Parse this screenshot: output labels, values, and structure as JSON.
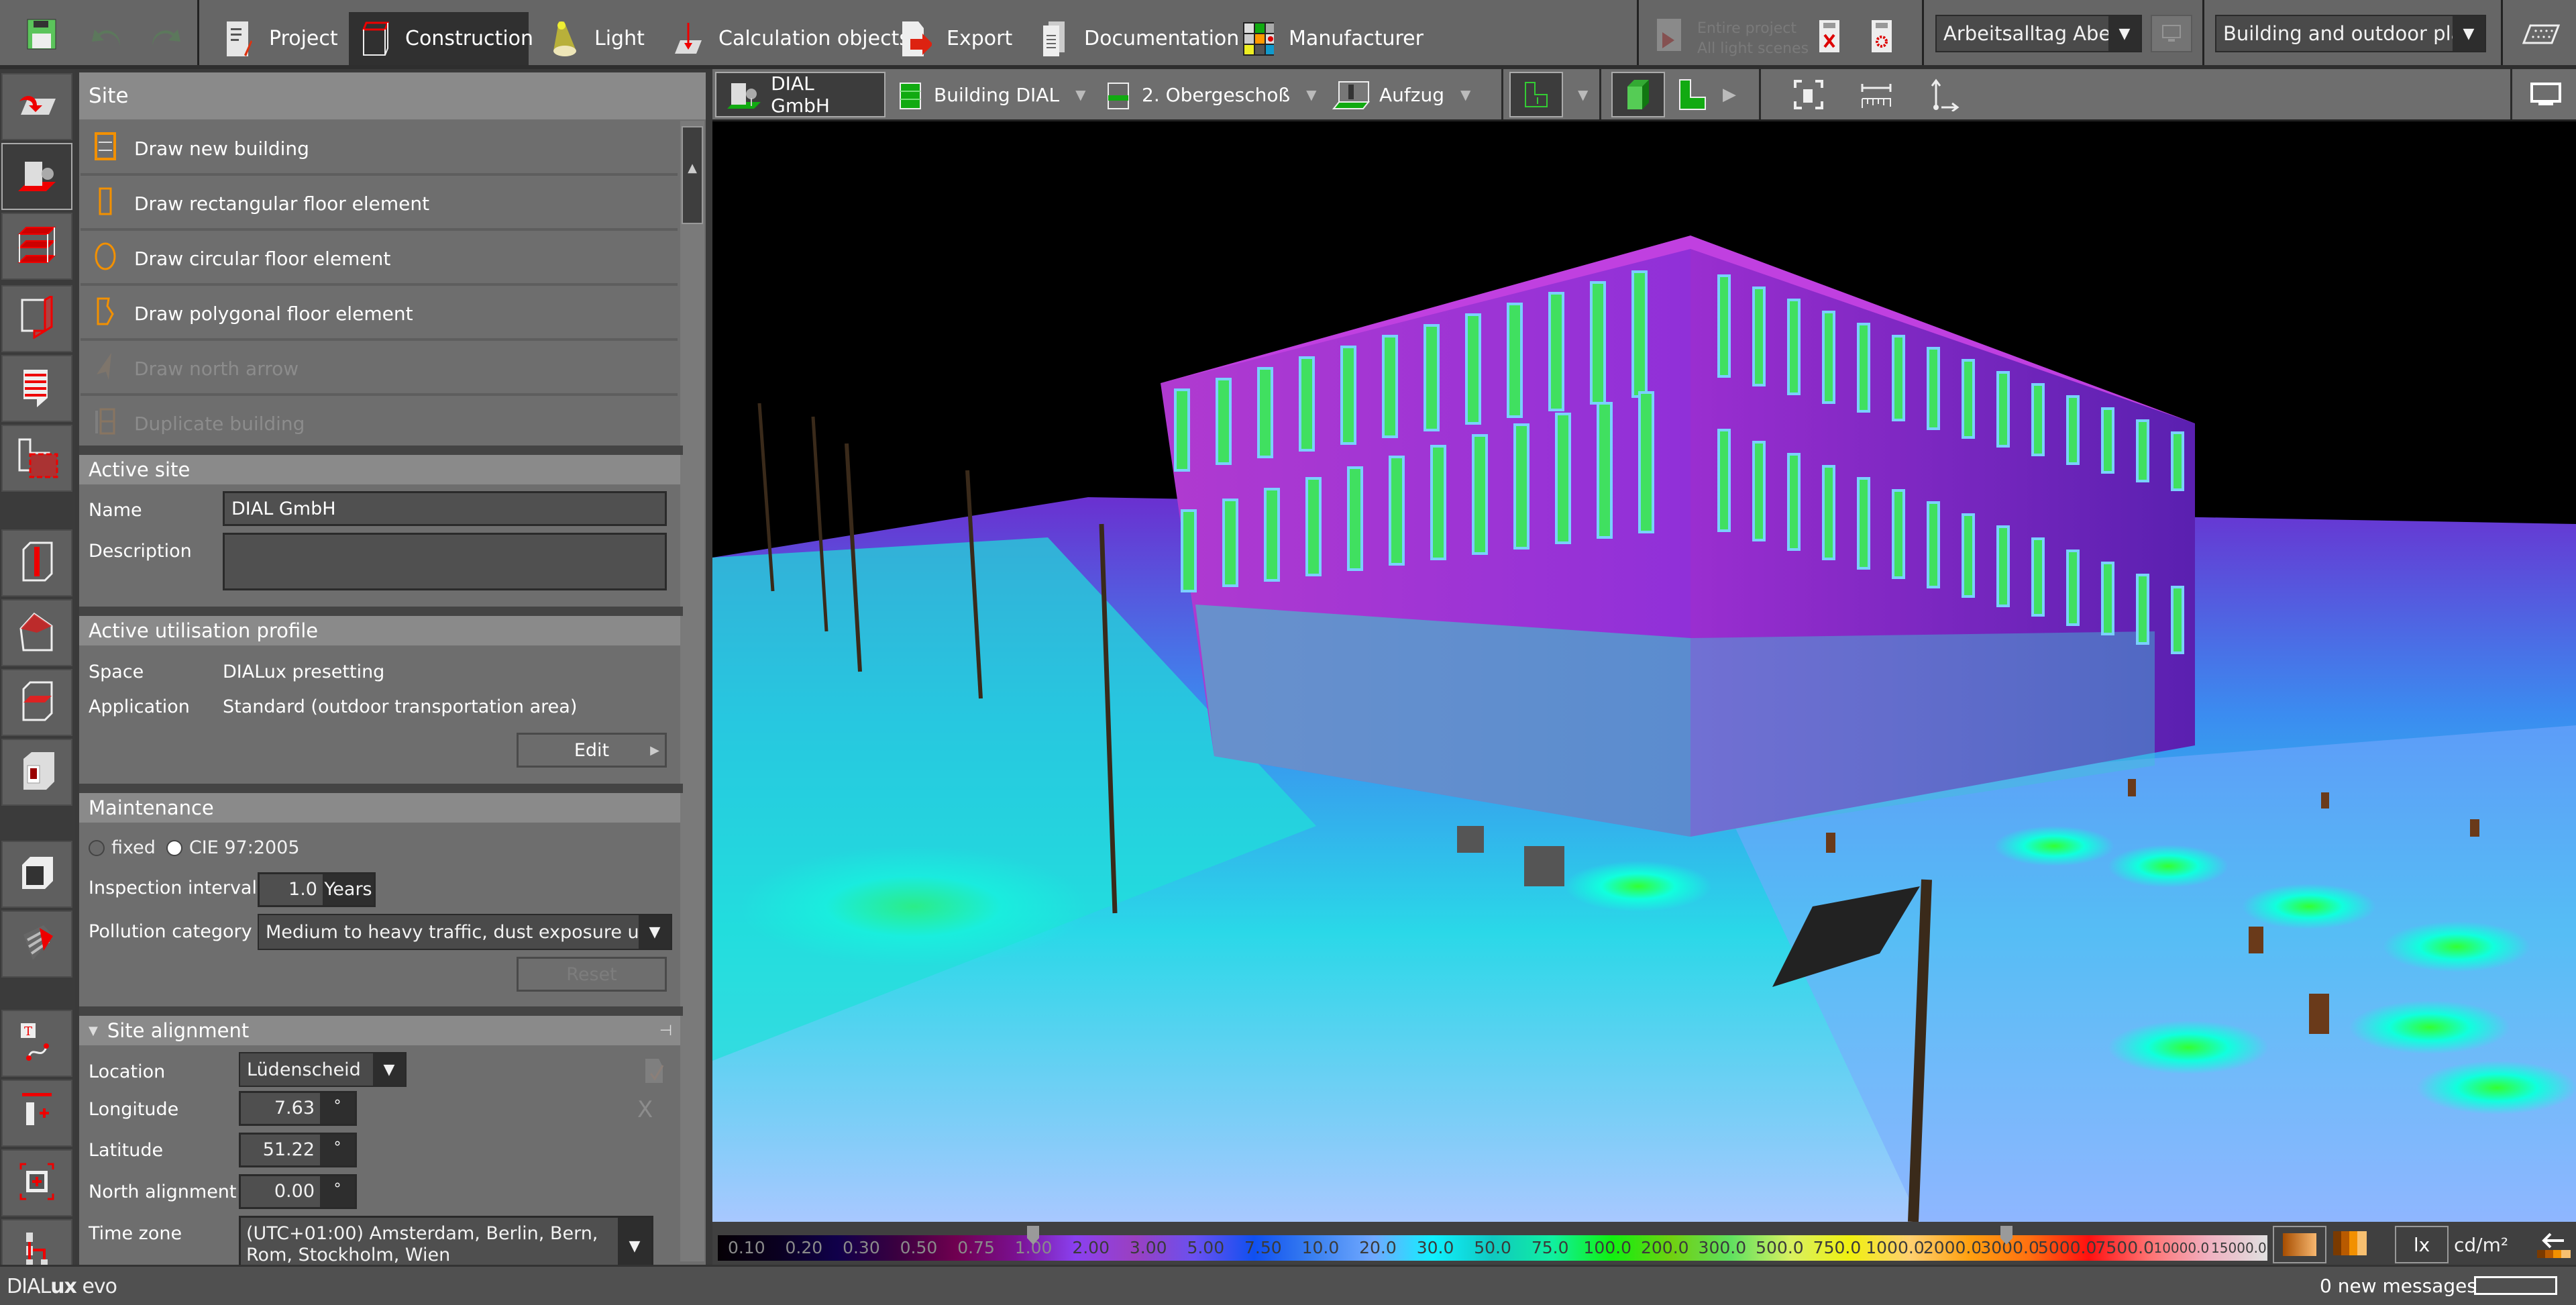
{
  "app": {
    "name_prefix": "DIAL",
    "name_bold": "ux",
    "name_suffix": " evo"
  },
  "topbar": {
    "save_icon": "save-icon",
    "undo_icon": "undo-icon",
    "redo_icon": "redo-icon",
    "tabs": [
      {
        "label": "Project",
        "icon": "project-icon",
        "active": false
      },
      {
        "label": "Construction",
        "icon": "construction-icon",
        "active": true
      },
      {
        "label": "Light",
        "icon": "light-icon",
        "active": false
      },
      {
        "label": "Calculation objects",
        "icon": "calculation-objects-icon",
        "active": false
      },
      {
        "label": "Export",
        "icon": "export-icon",
        "active": false
      },
      {
        "label": "Documentation",
        "icon": "documentation-icon",
        "active": false
      },
      {
        "label": "Manufacturer",
        "icon": "manufacturer-icon",
        "active": false
      }
    ],
    "calc": {
      "line1": "Entire project",
      "line2": "All light scenes"
    },
    "light_scene": {
      "value": "Arbeitsalltag Abend"
    },
    "view_preset": {
      "value": "Building and outdoor pla..."
    }
  },
  "rail": {
    "items": [
      "import-icon",
      "site-icon",
      "building-storeys-icon",
      "wall-icon",
      "facade-icon",
      "floor-element-icon",
      "column-icon",
      "roof-icon",
      "ceiling-icon",
      "room-icon",
      "extrusion-icon",
      "cutout-icon",
      "text-path-icon",
      "window-door-icon",
      "place-object-icon",
      "arrangement-icon"
    ]
  },
  "sidebar": {
    "title": "Site",
    "actions": [
      {
        "label": "Draw new building",
        "enabled": true
      },
      {
        "label": "Draw rectangular floor element",
        "enabled": true
      },
      {
        "label": "Draw circular floor element",
        "enabled": true
      },
      {
        "label": "Draw polygonal floor element",
        "enabled": true
      },
      {
        "label": "Draw north arrow",
        "enabled": false
      },
      {
        "label": "Duplicate building",
        "enabled": false
      }
    ],
    "active_site": {
      "title": "Active site",
      "name_label": "Name",
      "name_value": "DIAL GmbH",
      "description_label": "Description",
      "description_value": ""
    },
    "utilisation": {
      "title": "Active utilisation profile",
      "space_label": "Space",
      "space_value": "DIALux presetting",
      "application_label": "Application",
      "application_value": "Standard (outdoor transportation area)",
      "edit_label": "Edit"
    },
    "maintenance": {
      "title": "Maintenance",
      "radio_fixed": "fixed",
      "radio_cie": "CIE 97:2005",
      "selected": "CIE 97:2005",
      "inspection_label": "Inspection interval",
      "inspection_value": "1.0",
      "inspection_unit": "Years",
      "pollution_label": "Pollution category",
      "pollution_value": "Medium to heavy traffic, dust exposure unde",
      "reset_label": "Reset"
    },
    "alignment": {
      "title": "Site alignment",
      "location_label": "Location",
      "location_value": "Lüdenscheid",
      "longitude_label": "Longitude",
      "longitude_value": "7.63",
      "latitude_label": "Latitude",
      "latitude_value": "51.22",
      "north_label": "North alignment",
      "north_value": "0.00",
      "degree": "°",
      "timezone_label": "Time zone",
      "timezone_value": "(UTC+01:00) Amsterdam, Berlin, Bern, Rom, Stockholm, Wien",
      "confirm_icon": "confirm-icon",
      "clear_label": "X"
    }
  },
  "viewport_toolbar": {
    "site": "DIAL GmbH",
    "building": "Building DIAL",
    "storey": "2. Obergeschoß",
    "room": "Aufzug"
  },
  "scale": {
    "ticks": [
      "0.10",
      "0.20",
      "0.30",
      "0.50",
      "0.75",
      "1.00",
      "2.00",
      "3.00",
      "5.00",
      "7.50",
      "10.0",
      "20.0",
      "30.0",
      "50.0",
      "75.0",
      "100.0",
      "200.0",
      "300.0",
      "500.0",
      "750.0",
      "1000.0",
      "2000.0",
      "3000.0",
      "5000.0",
      "7500.0",
      "10000.0",
      "15000.0"
    ],
    "lower_marker": "1.00",
    "upper_marker": "3000.0",
    "unit_lx": "lx",
    "unit_cd": "cd/m²",
    "active_unit": "lx"
  },
  "status": {
    "messages": "0 new messages"
  }
}
